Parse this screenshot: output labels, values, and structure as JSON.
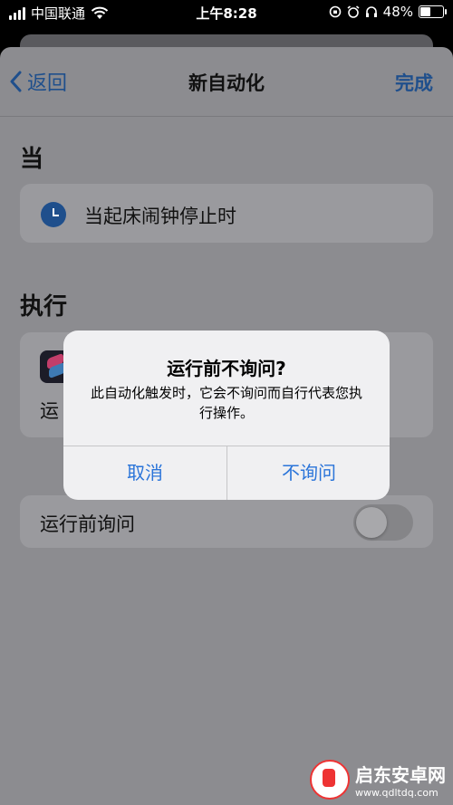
{
  "status_bar": {
    "carrier": "中国联通",
    "time": "上午8:28",
    "battery": "48%",
    "battery_level": 0.48
  },
  "nav": {
    "back_label": "返回",
    "title": "新自动化",
    "done_label": "完成"
  },
  "when": {
    "section_title": "当",
    "trigger_label": "当起床闹钟停止时",
    "trigger_icon": "clock-icon"
  },
  "execute": {
    "section_title": "执行",
    "action_label_partial": "运"
  },
  "ask_before_running": {
    "label": "运行前询问",
    "enabled": false
  },
  "alert": {
    "title": "运行前不询问?",
    "message": "此自动化触发时，它会不询问而自行代表您执行操作。",
    "cancel_label": "取消",
    "confirm_label": "不询问"
  },
  "watermark": {
    "name": "启东安卓网",
    "url": "www.qdltdq.com"
  },
  "colors": {
    "accent": "#2a74d9",
    "dim_accent": "#1f4f8c",
    "sheet_dimmed": "#8c8c90",
    "alert_bg": "#f0f0f2"
  }
}
